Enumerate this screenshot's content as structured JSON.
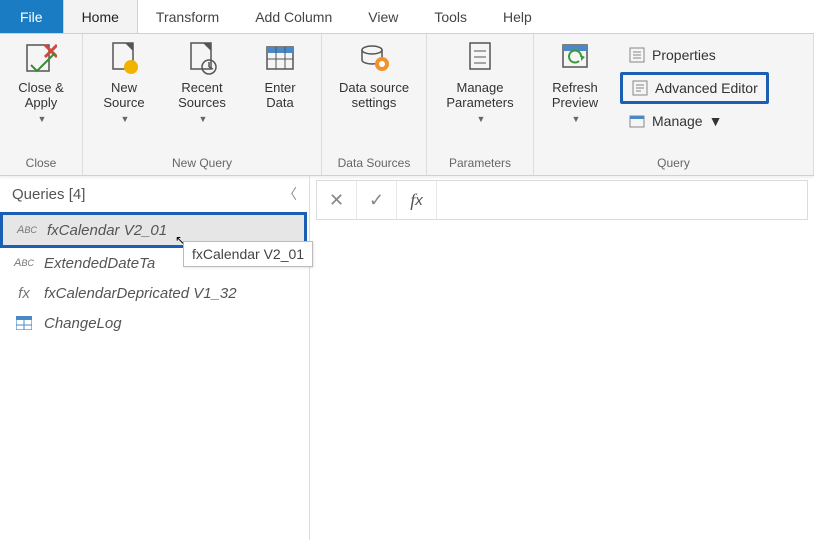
{
  "tabs": {
    "file": "File",
    "home": "Home",
    "transform": "Transform",
    "addcolumn": "Add Column",
    "view": "View",
    "tools": "Tools",
    "help": "Help"
  },
  "ribbon": {
    "close": {
      "close_apply": "Close &\nApply",
      "group": "Close"
    },
    "newquery": {
      "new_source": "New\nSource",
      "recent_sources": "Recent\nSources",
      "enter_data": "Enter\nData",
      "group": "New Query"
    },
    "datasources": {
      "data_source_settings": "Data source\nsettings",
      "group": "Data Sources"
    },
    "parameters": {
      "manage_parameters": "Manage\nParameters",
      "group": "Parameters"
    },
    "query": {
      "refresh_preview": "Refresh\nPreview",
      "properties": "Properties",
      "advanced_editor": "Advanced Editor",
      "manage": "Manage",
      "group": "Query"
    }
  },
  "queries": {
    "header": "Queries [4]",
    "items": [
      {
        "name": "fxCalendar V2_01",
        "type": "abc",
        "selected": true
      },
      {
        "name": "ExtendedDateTa",
        "type": "abc",
        "selected": false
      },
      {
        "name": "fxCalendarDepricated V1_32",
        "type": "fx",
        "selected": false
      },
      {
        "name": "ChangeLog",
        "type": "table",
        "selected": false
      }
    ],
    "tooltip": "fxCalendar V2_01"
  },
  "formula": {
    "value": ""
  }
}
